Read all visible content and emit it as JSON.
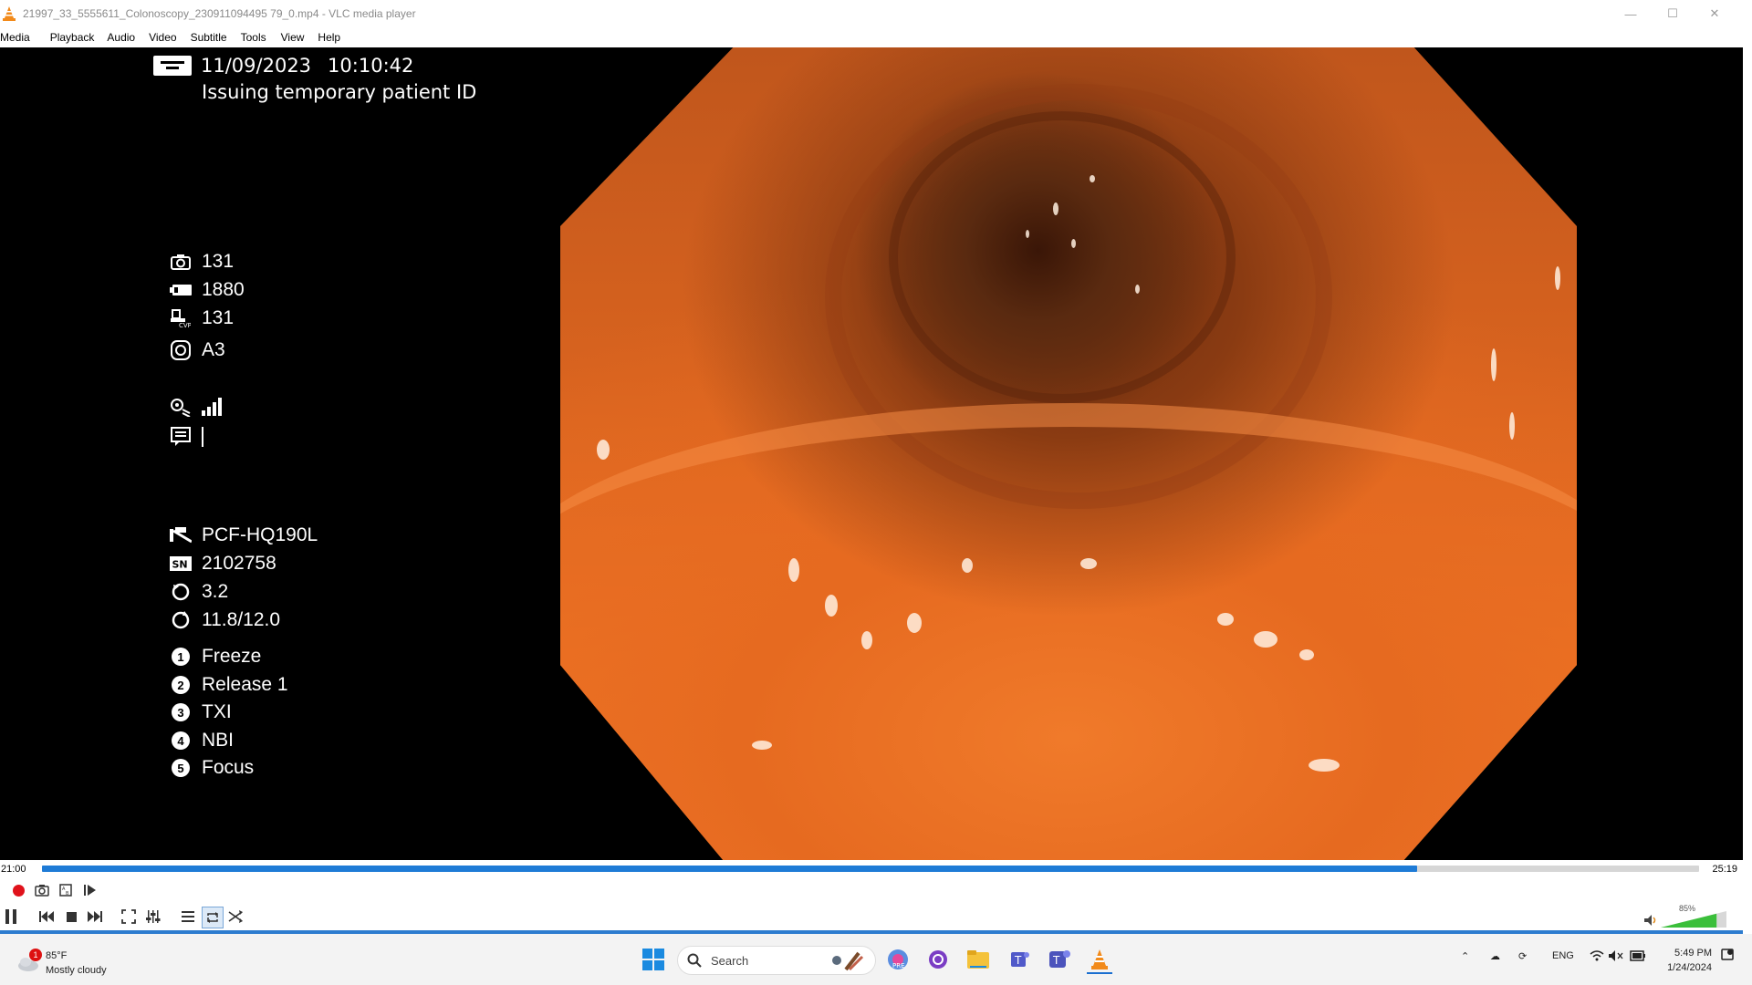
{
  "window": {
    "title": "21997_33_5555611_Colonoscopy_230911094495 79_0.mp4 - VLC media player",
    "buttons": {
      "minimize": "—",
      "maximize": "☐",
      "close": "✕"
    }
  },
  "menu": [
    "Media",
    "Playback",
    "Audio",
    "Video",
    "Subtitle",
    "Tools",
    "View",
    "Help"
  ],
  "osd": {
    "date": "11/09/2023",
    "time": "10:10:42",
    "patient": "Issuing temporary patient ID",
    "stats": [
      {
        "icon": "camera-icon",
        "value": "131"
      },
      {
        "icon": "battery-icon",
        "value": "1880"
      },
      {
        "icon": "cvp-icon",
        "value": "131"
      },
      {
        "icon": "mode-icon",
        "value": "A3"
      }
    ],
    "scope_info": [
      {
        "icon": "scope-model-icon",
        "value": "PCF-HQ190L"
      },
      {
        "icon": "serial-icon",
        "value": "2102758"
      },
      {
        "icon": "rotate-icon",
        "value": "3.2"
      },
      {
        "icon": "dial-icon",
        "value": "11.8/12.0"
      }
    ],
    "functions": [
      {
        "num": "1",
        "label": "Freeze"
      },
      {
        "num": "2",
        "label": "Release 1"
      },
      {
        "num": "3",
        "label": "TXI"
      },
      {
        "num": "4",
        "label": "NBI"
      },
      {
        "num": "5",
        "label": "Focus"
      }
    ]
  },
  "player": {
    "elapsed": "21:00",
    "total": "25:19",
    "progress": 0.83,
    "volume_pct": "85%",
    "volume": 0.85
  },
  "taskbar": {
    "temp": "85°F",
    "weather": "Mostly cloudy",
    "weather_badge": "1",
    "search_placeholder": "Search",
    "lang": "ENG",
    "time": "5:49 PM",
    "date": "1/24/2024"
  }
}
